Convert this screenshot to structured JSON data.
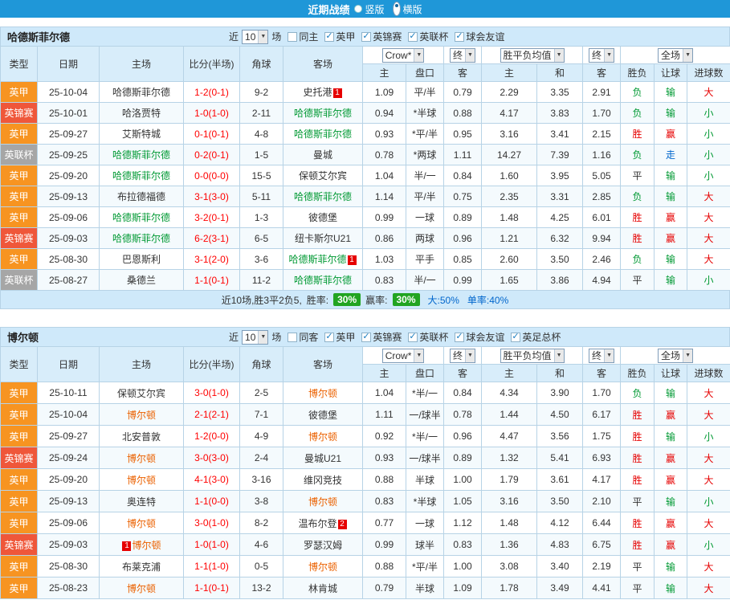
{
  "colors": {
    "topbar_bg": "#1f97d8",
    "panel_bg": "#cfe9fa",
    "header_bg": "#d8edfa",
    "grid_border": "#b7d3e6",
    "league_yijia": "#f79421",
    "league_jinbiaosai": "#ef573a",
    "league_lianbei": "#a6a6a6",
    "win_red": "#e60000",
    "lose_green": "#009933",
    "walk_blue": "#0066cc",
    "draw_black": "#333333",
    "score_red": "#ff0000",
    "rate_badge_green": "#21a421",
    "rate_blue": "#0066cc",
    "card_red": "#e60000"
  },
  "topbar": {
    "title": "近期战绩",
    "radios": [
      {
        "label": "竖版",
        "key": "vertical",
        "selected": false
      },
      {
        "label": "横版",
        "key": "horizontal",
        "selected": true
      }
    ]
  },
  "columns": {
    "main": [
      "类型",
      "日期",
      "主场",
      "比分(半场)",
      "角球",
      "客场"
    ],
    "sub": [
      "主",
      "盘口",
      "客",
      "主",
      "和",
      "客",
      "胜负",
      "让球",
      "进球数"
    ]
  },
  "sections": [
    {
      "team": "哈德斯菲尔德",
      "key": "huddersfield",
      "accent_color": "#009933",
      "filter": {
        "near_label": "近",
        "count": "10",
        "games_label": "场",
        "checkboxes": [
          {
            "label": "同主",
            "checked": false
          },
          {
            "label": "英甲",
            "checked": true
          },
          {
            "label": "英锦赛",
            "checked": true
          },
          {
            "label": "英联杯",
            "checked": true
          },
          {
            "label": "球会友谊",
            "checked": true
          }
        ]
      },
      "selects": [
        {
          "value": "Crow*",
          "span": 2,
          "name": "bookmaker-select"
        },
        {
          "value": "终",
          "span": 1,
          "name": "final-odds-select"
        },
        {
          "value": "胜平负均值",
          "span": 2,
          "name": "avg-odds-select"
        },
        {
          "value": "终",
          "span": 1,
          "name": "final-avg-select"
        },
        {
          "value": "全场",
          "span": 3,
          "name": "scope-select"
        }
      ],
      "rows": [
        {
          "league": "英甲",
          "date": "25-10-04",
          "home": {
            "name": "哈德斯菲尔德",
            "featured": false
          },
          "score": "1-2(0-1)",
          "corner": "9-2",
          "away": {
            "name": "史托港",
            "featured": false,
            "badge": "1",
            "badge_pos": "after"
          },
          "odds": [
            "1.09",
            "平/半",
            "0.79"
          ],
          "avg": [
            "2.29",
            "3.35",
            "2.91"
          ],
          "results": [
            [
              "负",
              "g"
            ],
            [
              "输",
              "g"
            ],
            [
              "大",
              "r"
            ]
          ]
        },
        {
          "league": "英锦赛",
          "date": "25-10-01",
          "home": {
            "name": "哈洛贾特",
            "featured": false
          },
          "score": "1-0(1-0)",
          "corner": "2-11",
          "away": {
            "name": "哈德斯菲尔德",
            "featured": true
          },
          "odds": [
            "0.94",
            "*半球",
            "0.88"
          ],
          "avg": [
            "4.17",
            "3.83",
            "1.70"
          ],
          "results": [
            [
              "负",
              "g"
            ],
            [
              "输",
              "g"
            ],
            [
              "小",
              "g"
            ]
          ]
        },
        {
          "league": "英甲",
          "date": "25-09-27",
          "home": {
            "name": "艾斯特城",
            "featured": false
          },
          "score": "0-1(0-1)",
          "corner": "4-8",
          "away": {
            "name": "哈德斯菲尔德",
            "featured": true
          },
          "odds": [
            "0.93",
            "*平/半",
            "0.95"
          ],
          "avg": [
            "3.16",
            "3.41",
            "2.15"
          ],
          "results": [
            [
              "胜",
              "r"
            ],
            [
              "赢",
              "r"
            ],
            [
              "小",
              "g"
            ]
          ]
        },
        {
          "league": "英联杯",
          "date": "25-09-25",
          "home": {
            "name": "哈德斯菲尔德",
            "featured": true
          },
          "score": "0-2(0-1)",
          "corner": "1-5",
          "away": {
            "name": "曼城",
            "featured": false
          },
          "odds": [
            "0.78",
            "*两球",
            "1.11"
          ],
          "avg": [
            "14.27",
            "7.39",
            "1.16"
          ],
          "results": [
            [
              "负",
              "g"
            ],
            [
              "走",
              "b"
            ],
            [
              "小",
              "g"
            ]
          ]
        },
        {
          "league": "英甲",
          "date": "25-09-20",
          "home": {
            "name": "哈德斯菲尔德",
            "featured": true
          },
          "score": "0-0(0-0)",
          "corner": "15-5",
          "away": {
            "name": "保顿艾尔宾",
            "featured": false
          },
          "odds": [
            "1.04",
            "半/一",
            "0.84"
          ],
          "avg": [
            "1.60",
            "3.95",
            "5.05"
          ],
          "results": [
            [
              "平",
              "k"
            ],
            [
              "输",
              "g"
            ],
            [
              "小",
              "g"
            ]
          ]
        },
        {
          "league": "英甲",
          "date": "25-09-13",
          "home": {
            "name": "布拉德福德",
            "featured": false
          },
          "score": "3-1(3-0)",
          "corner": "5-11",
          "away": {
            "name": "哈德斯菲尔德",
            "featured": true
          },
          "odds": [
            "1.14",
            "平/半",
            "0.75"
          ],
          "avg": [
            "2.35",
            "3.31",
            "2.85"
          ],
          "results": [
            [
              "负",
              "g"
            ],
            [
              "输",
              "g"
            ],
            [
              "大",
              "r"
            ]
          ]
        },
        {
          "league": "英甲",
          "date": "25-09-06",
          "home": {
            "name": "哈德斯菲尔德",
            "featured": true
          },
          "score": "3-2(0-1)",
          "corner": "1-3",
          "away": {
            "name": "彼德堡",
            "featured": false
          },
          "odds": [
            "0.99",
            "一球",
            "0.89"
          ],
          "avg": [
            "1.48",
            "4.25",
            "6.01"
          ],
          "results": [
            [
              "胜",
              "r"
            ],
            [
              "赢",
              "r"
            ],
            [
              "大",
              "r"
            ]
          ]
        },
        {
          "league": "英锦赛",
          "date": "25-09-03",
          "home": {
            "name": "哈德斯菲尔德",
            "featured": true
          },
          "score": "6-2(3-1)",
          "corner": "6-5",
          "away": {
            "name": "纽卡斯尔U21",
            "featured": false
          },
          "odds": [
            "0.86",
            "两球",
            "0.96"
          ],
          "avg": [
            "1.21",
            "6.32",
            "9.94"
          ],
          "results": [
            [
              "胜",
              "r"
            ],
            [
              "赢",
              "r"
            ],
            [
              "大",
              "r"
            ]
          ]
        },
        {
          "league": "英甲",
          "date": "25-08-30",
          "home": {
            "name": "巴恩斯利",
            "featured": false
          },
          "score": "3-1(2-0)",
          "corner": "3-6",
          "away": {
            "name": "哈德斯菲尔德",
            "featured": true,
            "badge": "1",
            "badge_pos": "after"
          },
          "odds": [
            "1.03",
            "平手",
            "0.85"
          ],
          "avg": [
            "2.60",
            "3.50",
            "2.46"
          ],
          "results": [
            [
              "负",
              "g"
            ],
            [
              "输",
              "g"
            ],
            [
              "大",
              "r"
            ]
          ]
        },
        {
          "league": "英联杯",
          "date": "25-08-27",
          "home": {
            "name": "桑德兰",
            "featured": false
          },
          "score": "1-1(0-1)",
          "corner": "11-2",
          "away": {
            "name": "哈德斯菲尔德",
            "featured": true
          },
          "odds": [
            "0.83",
            "半/一",
            "0.99"
          ],
          "avg": [
            "1.65",
            "3.86",
            "4.94"
          ],
          "results": [
            [
              "平",
              "k"
            ],
            [
              "输",
              "g"
            ],
            [
              "小",
              "g"
            ]
          ]
        }
      ],
      "summary": {
        "record": "近10场,胜3平2负5,",
        "win_rate_label": "胜率:",
        "win_rate": "30%",
        "profit_rate_label": "赢率:",
        "profit_rate": "30%",
        "big_rate": "大:50%",
        "single_rate": "单率:40%"
      }
    },
    {
      "team": "博尔顿",
      "key": "bolton",
      "accent_color": "#eb6100",
      "filter": {
        "near_label": "近",
        "count": "10",
        "games_label": "场",
        "checkboxes": [
          {
            "label": "同客",
            "checked": false
          },
          {
            "label": "英甲",
            "checked": true
          },
          {
            "label": "英锦赛",
            "checked": true
          },
          {
            "label": "英联杯",
            "checked": true
          },
          {
            "label": "球会友谊",
            "checked": true
          },
          {
            "label": "英足总杯",
            "checked": true
          }
        ]
      },
      "selects": [
        {
          "value": "Crow*",
          "span": 2,
          "name": "bookmaker-select"
        },
        {
          "value": "终",
          "span": 1,
          "name": "final-odds-select"
        },
        {
          "value": "胜平负均值",
          "span": 2,
          "name": "avg-odds-select"
        },
        {
          "value": "终",
          "span": 1,
          "name": "final-avg-select"
        },
        {
          "value": "全场",
          "span": 3,
          "name": "scope-select"
        }
      ],
      "rows": [
        {
          "league": "英甲",
          "date": "25-10-11",
          "home": {
            "name": "保顿艾尔宾",
            "featured": false
          },
          "score": "3-0(1-0)",
          "corner": "2-5",
          "away": {
            "name": "博尔顿",
            "featured": true
          },
          "odds": [
            "1.04",
            "*半/一",
            "0.84"
          ],
          "avg": [
            "4.34",
            "3.90",
            "1.70"
          ],
          "results": [
            [
              "负",
              "g"
            ],
            [
              "输",
              "g"
            ],
            [
              "大",
              "r"
            ]
          ]
        },
        {
          "league": "英甲",
          "date": "25-10-04",
          "home": {
            "name": "博尔顿",
            "featured": true
          },
          "score": "2-1(2-1)",
          "corner": "7-1",
          "away": {
            "name": "彼德堡",
            "featured": false
          },
          "odds": [
            "1.11",
            "一/球半",
            "0.78"
          ],
          "avg": [
            "1.44",
            "4.50",
            "6.17"
          ],
          "results": [
            [
              "胜",
              "r"
            ],
            [
              "赢",
              "r"
            ],
            [
              "大",
              "r"
            ]
          ]
        },
        {
          "league": "英甲",
          "date": "25-09-27",
          "home": {
            "name": "北安普敦",
            "featured": false
          },
          "score": "1-2(0-0)",
          "corner": "4-9",
          "away": {
            "name": "博尔顿",
            "featured": true
          },
          "odds": [
            "0.92",
            "*半/一",
            "0.96"
          ],
          "avg": [
            "4.47",
            "3.56",
            "1.75"
          ],
          "results": [
            [
              "胜",
              "r"
            ],
            [
              "输",
              "g"
            ],
            [
              "小",
              "g"
            ]
          ]
        },
        {
          "league": "英锦赛",
          "date": "25-09-24",
          "home": {
            "name": "博尔顿",
            "featured": true
          },
          "score": "3-0(3-0)",
          "corner": "2-4",
          "away": {
            "name": "曼城U21",
            "featured": false
          },
          "odds": [
            "0.93",
            "一/球半",
            "0.89"
          ],
          "avg": [
            "1.32",
            "5.41",
            "6.93"
          ],
          "results": [
            [
              "胜",
              "r"
            ],
            [
              "赢",
              "r"
            ],
            [
              "大",
              "r"
            ]
          ]
        },
        {
          "league": "英甲",
          "date": "25-09-20",
          "home": {
            "name": "博尔顿",
            "featured": true
          },
          "score": "4-1(3-0)",
          "corner": "3-16",
          "away": {
            "name": "维冈竞技",
            "featured": false
          },
          "odds": [
            "0.88",
            "半球",
            "1.00"
          ],
          "avg": [
            "1.79",
            "3.61",
            "4.17"
          ],
          "results": [
            [
              "胜",
              "r"
            ],
            [
              "赢",
              "r"
            ],
            [
              "大",
              "r"
            ]
          ]
        },
        {
          "league": "英甲",
          "date": "25-09-13",
          "home": {
            "name": "奥连特",
            "featured": false
          },
          "score": "1-1(0-0)",
          "corner": "3-8",
          "away": {
            "name": "博尔顿",
            "featured": true
          },
          "odds": [
            "0.83",
            "*半球",
            "1.05"
          ],
          "avg": [
            "3.16",
            "3.50",
            "2.10"
          ],
          "results": [
            [
              "平",
              "k"
            ],
            [
              "输",
              "g"
            ],
            [
              "小",
              "g"
            ]
          ]
        },
        {
          "league": "英甲",
          "date": "25-09-06",
          "home": {
            "name": "博尔顿",
            "featured": true
          },
          "score": "3-0(1-0)",
          "corner": "8-2",
          "away": {
            "name": "温布尔登",
            "featured": false,
            "badge": "2",
            "badge_pos": "after"
          },
          "odds": [
            "0.77",
            "一球",
            "1.12"
          ],
          "avg": [
            "1.48",
            "4.12",
            "6.44"
          ],
          "results": [
            [
              "胜",
              "r"
            ],
            [
              "赢",
              "r"
            ],
            [
              "大",
              "r"
            ]
          ]
        },
        {
          "league": "英锦赛",
          "date": "25-09-03",
          "home": {
            "name": "博尔顿",
            "featured": true,
            "badge": "1",
            "badge_pos": "before"
          },
          "score": "1-0(1-0)",
          "corner": "4-6",
          "away": {
            "name": "罗瑟汉姆",
            "featured": false
          },
          "odds": [
            "0.99",
            "球半",
            "0.83"
          ],
          "avg": [
            "1.36",
            "4.83",
            "6.75"
          ],
          "results": [
            [
              "胜",
              "r"
            ],
            [
              "赢",
              "r"
            ],
            [
              "小",
              "g"
            ]
          ]
        },
        {
          "league": "英甲",
          "date": "25-08-30",
          "home": {
            "name": "布莱克浦",
            "featured": false
          },
          "score": "1-1(1-0)",
          "corner": "0-5",
          "away": {
            "name": "博尔顿",
            "featured": true
          },
          "odds": [
            "0.88",
            "*平/半",
            "1.00"
          ],
          "avg": [
            "3.08",
            "3.40",
            "2.19"
          ],
          "results": [
            [
              "平",
              "k"
            ],
            [
              "输",
              "g"
            ],
            [
              "大",
              "r"
            ]
          ]
        },
        {
          "league": "英甲",
          "date": "25-08-23",
          "home": {
            "name": "博尔顿",
            "featured": true
          },
          "score": "1-1(0-1)",
          "corner": "13-2",
          "away": {
            "name": "林肯城",
            "featured": false
          },
          "odds": [
            "0.79",
            "半球",
            "1.09"
          ],
          "avg": [
            "1.78",
            "3.49",
            "4.41"
          ],
          "results": [
            [
              "平",
              "k"
            ],
            [
              "输",
              "g"
            ],
            [
              "大",
              "r"
            ]
          ]
        }
      ]
    }
  ]
}
